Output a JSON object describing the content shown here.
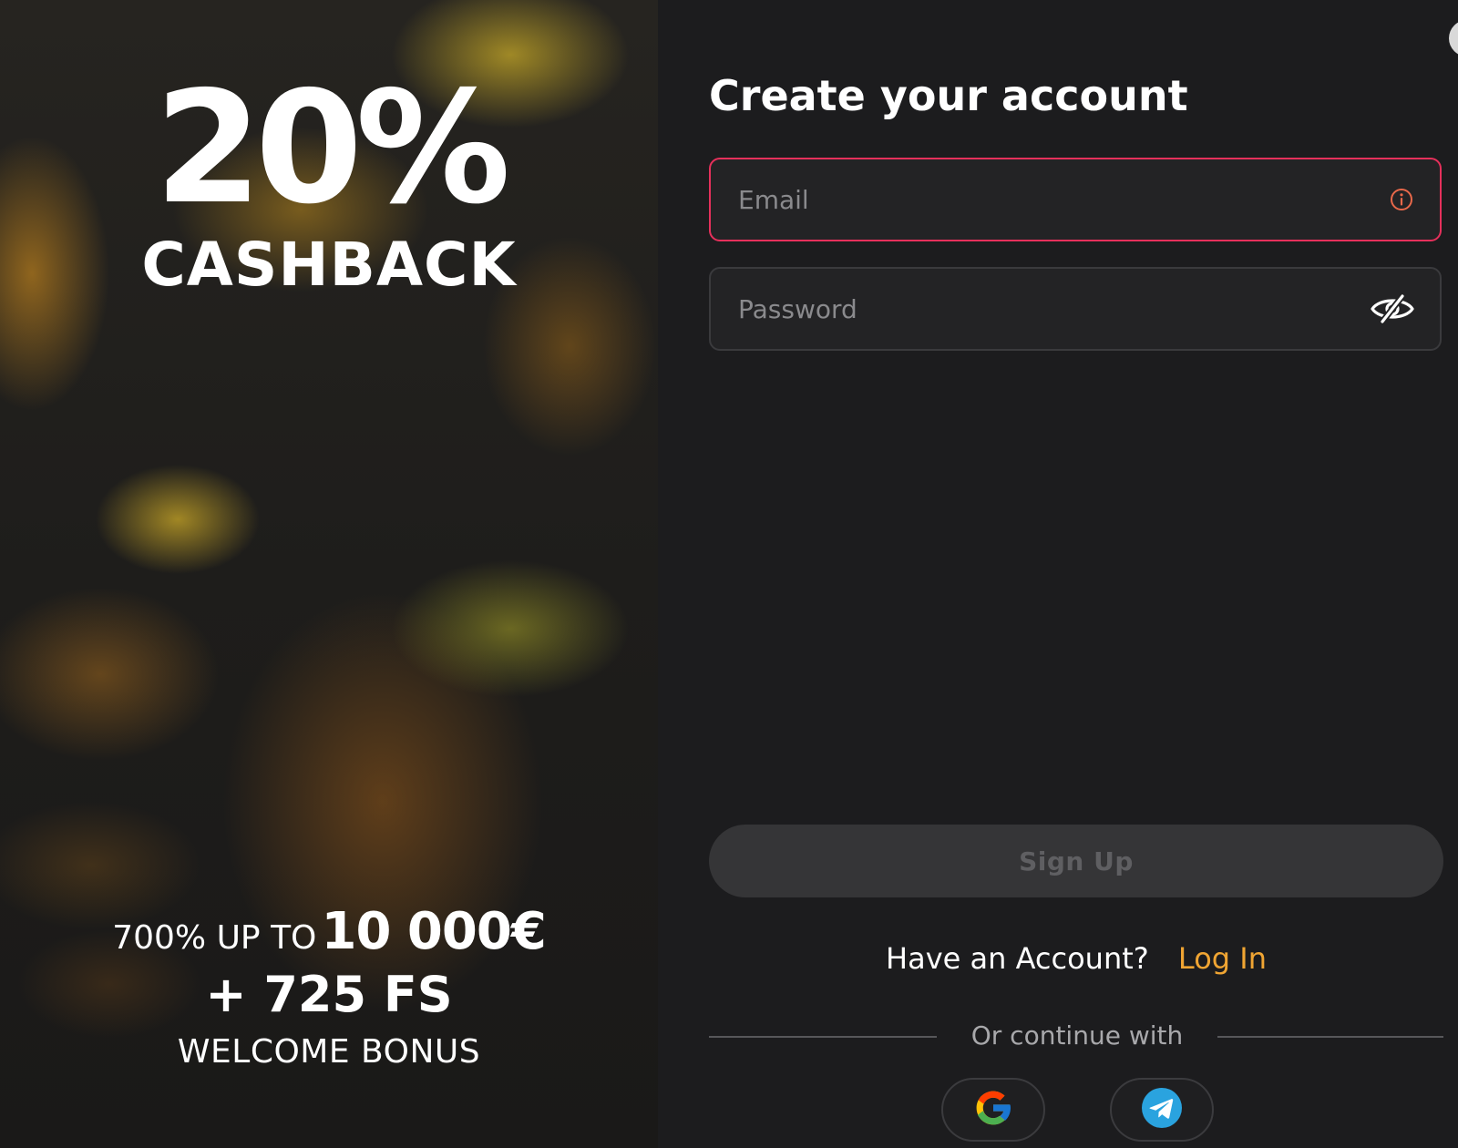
{
  "promo": {
    "percent": "20%",
    "cashback": "CASHBACK",
    "offer_prefix": "700% UP TO",
    "offer_amount": "10 000€",
    "free_spins": "+ 725 FS",
    "welcome": "WELCOME BONUS"
  },
  "form": {
    "title": "Create your account",
    "email_placeholder": "Email",
    "password_placeholder": "Password",
    "signup_label": "Sign Up",
    "have_account": "Have an Account?",
    "login_label": "Log In",
    "or_continue": "Or continue with"
  },
  "icons": {
    "email_status": "info-icon",
    "password_toggle": "eye-slash-icon",
    "google": "google-icon",
    "telegram": "telegram-icon",
    "close": "close-icon"
  },
  "colors": {
    "email_border_error": "#e5305b",
    "login_link": "#f0a533",
    "info_icon": "#e8684a",
    "telegram": "#2aa3df"
  }
}
